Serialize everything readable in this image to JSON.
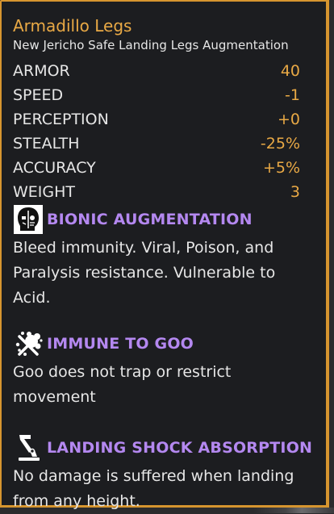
{
  "item": {
    "title": "Armadillo Legs",
    "subtitle": "New Jericho Safe Landing Legs Augmentation"
  },
  "stats": [
    {
      "label": "ARMOR",
      "value": "40"
    },
    {
      "label": "SPEED",
      "value": "-1"
    },
    {
      "label": "PERCEPTION",
      "value": "+0"
    },
    {
      "label": "STEALTH",
      "value": "-25%"
    },
    {
      "label": "ACCURACY",
      "value": "+5%"
    },
    {
      "label": "WEIGHT",
      "value": "3"
    }
  ],
  "traits": [
    {
      "icon": "bionic-head-icon",
      "name": "BIONIC AUGMENTATION",
      "description": "Bleed immunity. Viral, Poison, and Paralysis resistance. Vulnerable to Acid."
    },
    {
      "icon": "goo-splash-icon",
      "name": "IMMUNE TO GOO",
      "description": "Goo does not trap or restrict movement"
    },
    {
      "icon": "robotic-leg-icon",
      "name": "LANDING SHOCK ABSORPTION",
      "description": "No damage is suffered when landing from any height."
    }
  ],
  "colors": {
    "border": "#d6952f",
    "title": "#e9a945",
    "stat_value": "#e9a945",
    "trait_name": "#b488f0",
    "text": "#e6e6e6",
    "panel_bg": "#1c1d20"
  }
}
